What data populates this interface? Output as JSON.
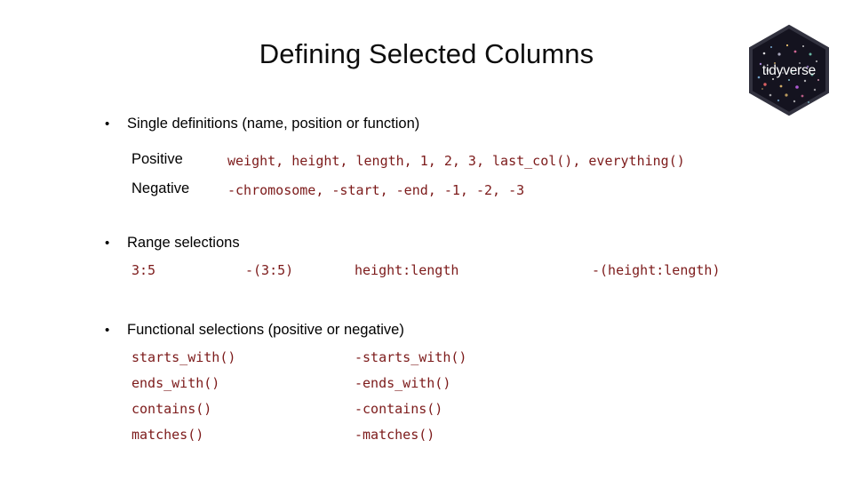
{
  "slide": {
    "title": "Defining Selected Columns",
    "code_color": "#7C1A1A",
    "text_color": "#000000",
    "background_color": "#ffffff"
  },
  "logo": {
    "name": "tidyverse",
    "label": "tidyverse",
    "hex_fill": "#14131f",
    "hex_border": "#2b2b38"
  },
  "sections": {
    "single": {
      "bullet": "•",
      "heading": "Single definitions (name, position or function)",
      "rows": [
        {
          "label": "Positive",
          "code": "weight, height, length, 1, 2, 3, last_col(), everything()"
        },
        {
          "label": "Negative",
          "code": "-chromosome, -start, -end, -1, -2, -3"
        }
      ]
    },
    "range": {
      "bullet": "•",
      "heading": "Range selections",
      "examples": [
        "3:5",
        "-(3:5)",
        "height:length",
        "-(height:length)"
      ]
    },
    "functional": {
      "bullet": "•",
      "heading": "Functional selections (positive or negative)",
      "rows": [
        {
          "positive": "starts_with()",
          "negative": "-starts_with()"
        },
        {
          "positive": "ends_with()",
          "negative": "-ends_with()"
        },
        {
          "positive": "contains()",
          "negative": "-contains()"
        },
        {
          "positive": "matches()",
          "negative": "-matches()"
        }
      ]
    }
  }
}
